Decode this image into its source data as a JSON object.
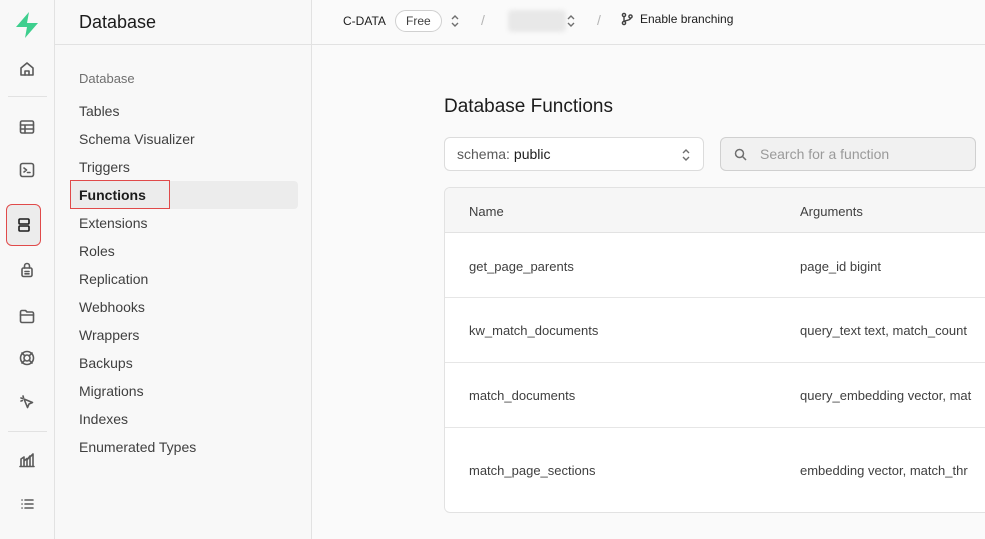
{
  "app": {
    "accent_color": "#3ecf8e",
    "highlight_color": "#e04a4a"
  },
  "rail": {
    "icons": [
      "logo-icon",
      "home-icon",
      "table-editor-icon",
      "sql-editor-icon",
      "database-icon",
      "auth-icon",
      "storage-icon",
      "edge-functions-icon",
      "realtime-icon",
      "reports-icon",
      "logs-icon"
    ],
    "active": "database-icon"
  },
  "menu": {
    "header": "Database",
    "group_title": "Database",
    "items": [
      {
        "label": "Tables"
      },
      {
        "label": "Schema Visualizer"
      },
      {
        "label": "Triggers"
      },
      {
        "label": "Functions",
        "active": true
      },
      {
        "label": "Extensions"
      },
      {
        "label": "Roles"
      },
      {
        "label": "Replication"
      },
      {
        "label": "Webhooks"
      },
      {
        "label": "Wrappers"
      },
      {
        "label": "Backups"
      },
      {
        "label": "Migrations"
      },
      {
        "label": "Indexes"
      },
      {
        "label": "Enumerated Types"
      }
    ]
  },
  "topbar": {
    "org_name": "C-DATA",
    "plan_badge": "Free",
    "separator": "/",
    "branching_label": "Enable branching"
  },
  "main": {
    "title": "Database Functions",
    "schema_label": "schema:",
    "schema_value": "public",
    "search_placeholder": "Search for a function",
    "table": {
      "columns": [
        "Name",
        "Arguments"
      ],
      "rows": [
        {
          "name": "get_page_parents",
          "args": "page_id bigint"
        },
        {
          "name": "kw_match_documents",
          "args": "query_text text, match_count"
        },
        {
          "name": "match_documents",
          "args": "query_embedding vector, mat"
        },
        {
          "name": "match_page_sections",
          "args": "embedding vector, match_thr"
        }
      ]
    }
  }
}
